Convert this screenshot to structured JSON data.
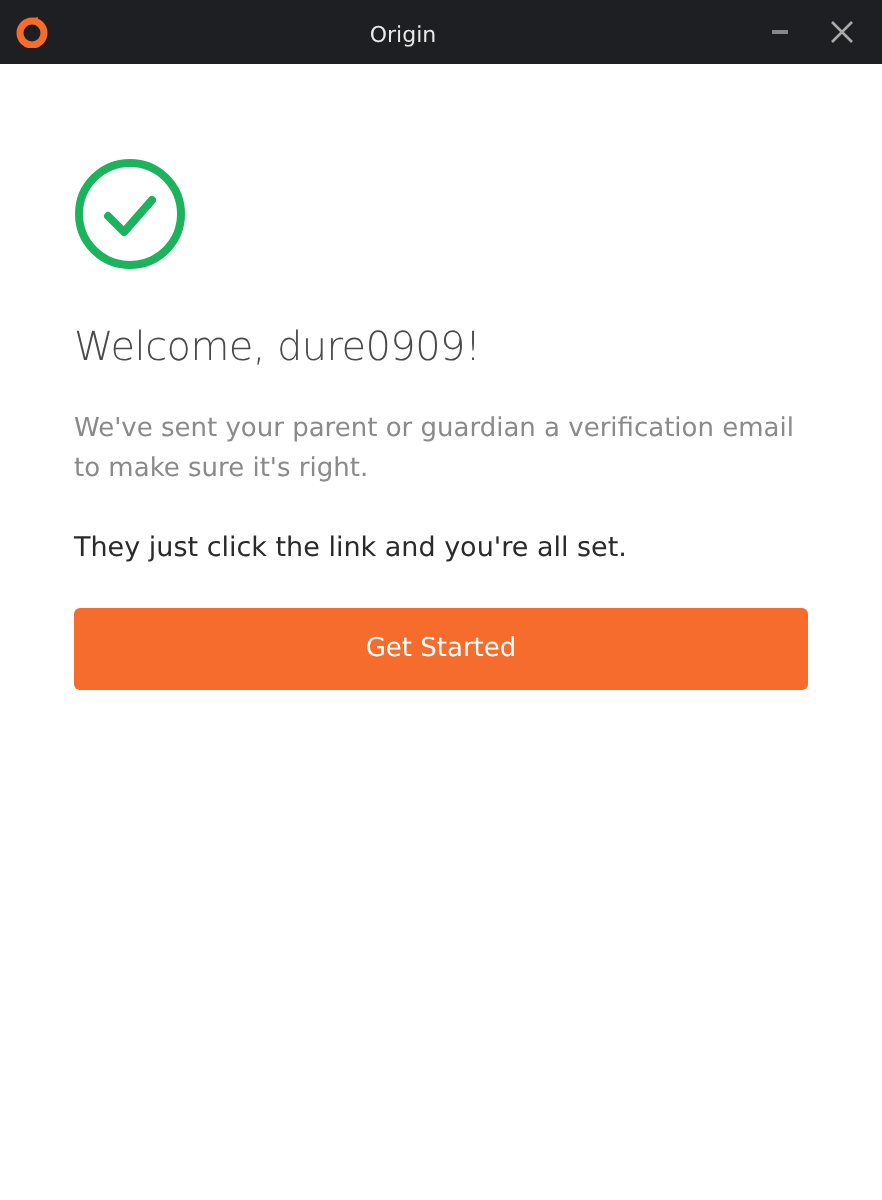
{
  "window": {
    "title": "Origin"
  },
  "heading": "Welcome, dure0909!",
  "message": "We've sent your parent or guardian a verification email to make sure it's right.",
  "note": "They just click the link and you're all set.",
  "buttons": [
    "Get Started"
  ]
}
